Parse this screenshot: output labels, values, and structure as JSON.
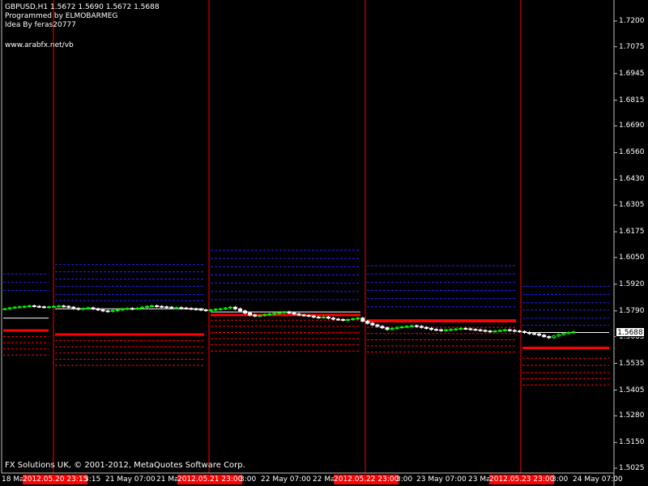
{
  "header": {
    "symbol_line": "GBPUSD,H1  1.5672 1.5690 1.5672 1.5688",
    "line2": "Programmed by ELMOBARMEG",
    "line3": "Idea By feras20777",
    "url": "www.arabfx.net/vb"
  },
  "current_price": "1.5688",
  "footer": "FX Solutions UK, © 2001-2012, MetaQuotes Software Corp.",
  "x_labels": [
    {
      "text": "18 Ma",
      "red": false
    },
    {
      "text": "2012.05.20 23:15",
      "red": true
    },
    {
      "text": "3:15",
      "red": false
    },
    {
      "text": "21 May 07:00",
      "red": false
    },
    {
      "text": "21 Ma",
      "red": false
    },
    {
      "text": "2012.05.21 23:00",
      "red": true
    },
    {
      "text": "3:00",
      "red": false
    },
    {
      "text": "22 May 07:00",
      "red": false
    },
    {
      "text": "22 Ma",
      "red": false
    },
    {
      "text": "2012.05.22 23:00",
      "red": true
    },
    {
      "text": "3:00",
      "red": false
    },
    {
      "text": "23 May 07:00",
      "red": false
    },
    {
      "text": "23 Ma",
      "red": false
    },
    {
      "text": "2012.05.23 23:00",
      "red": true
    },
    {
      "text": "3:00",
      "red": false
    },
    {
      "text": "24 May 07:00",
      "red": false
    }
  ],
  "colors": {
    "background": "#000000",
    "candle_up": "#00ff00",
    "candle_down": "#ffffff",
    "separator": "#ff0000",
    "pivot": "#ff0000",
    "resistance": "#2020ff",
    "support": "#ff0000"
  },
  "chart_data": {
    "type": "candlestick",
    "ylim": [
      1.5025,
      1.7255
    ],
    "y_ticks": [
      "1.7200",
      "1.7075",
      "1.6945",
      "1.6815",
      "1.6690",
      "1.6560",
      "1.6430",
      "1.6305",
      "1.6175",
      "1.6050",
      "1.5920",
      "1.5790",
      "1.5665",
      "1.5535",
      "1.5405",
      "1.5280",
      "1.5150",
      "1.5025"
    ],
    "sessions": [
      {
        "pivot": 1.5695,
        "prev_close": 1.5755,
        "resistance": [
          1.589,
          1.593,
          1.597
        ],
        "support": [
          1.5665,
          1.5635,
          1.5605,
          1.5575
        ]
      },
      {
        "pivot": 1.5675,
        "prev_close": 1.58,
        "resistance": [
          1.584,
          1.587,
          1.591,
          1.5945,
          1.598,
          1.6015
        ],
        "support": [
          1.5645,
          1.5615,
          1.5585,
          1.5555,
          1.5525
        ]
      },
      {
        "pivot": 1.577,
        "prev_close": 1.5785,
        "resistance": [
          1.5845,
          1.5885,
          1.5925,
          1.5965,
          1.6005,
          1.6045,
          1.6085
        ],
        "support": [
          1.5745,
          1.5715,
          1.5685,
          1.5655,
          1.5625,
          1.5595
        ]
      },
      {
        "pivot": 1.574,
        "prev_close": 1.5745,
        "resistance": [
          1.581,
          1.585,
          1.589,
          1.593,
          1.597,
          1.601
        ],
        "support": [
          1.571,
          1.568,
          1.565,
          1.562,
          1.559
        ]
      },
      {
        "pivot": 1.561,
        "prev_close": 1.5685,
        "resistance": [
          1.572,
          1.5755,
          1.5795,
          1.583,
          1.587,
          1.591
        ],
        "support": [
          1.556,
          1.5525,
          1.549,
          1.546,
          1.543
        ]
      }
    ],
    "closes": [
      1.58,
      1.5805,
      1.5808,
      1.581,
      1.5812,
      1.5815,
      1.5812,
      1.581,
      1.5808,
      1.581,
      1.5812,
      1.5814,
      1.5812,
      1.5808,
      1.5802,
      1.5798,
      1.5802,
      1.5805,
      1.58,
      1.5795,
      1.579,
      1.5788,
      1.5792,
      1.5795,
      1.58,
      1.5802,
      1.58,
      1.5803,
      1.5808,
      1.5812,
      1.5815,
      1.5812,
      1.581,
      1.5808,
      1.5805,
      1.5806,
      1.5804,
      1.5802,
      1.58,
      1.5798,
      1.5795,
      1.5792,
      1.5795,
      1.5798,
      1.58,
      1.5804,
      1.5808,
      1.58,
      1.579,
      1.578,
      1.577,
      1.5765,
      1.5768,
      1.5772,
      1.5775,
      1.5778,
      1.5782,
      1.5785,
      1.578,
      1.5775,
      1.577,
      1.5768,
      1.5765,
      1.576,
      1.5758,
      1.576,
      1.5755,
      1.575,
      1.5748,
      1.5745,
      1.5748,
      1.5752,
      1.5755,
      1.574,
      1.573,
      1.5722,
      1.5715,
      1.5708,
      1.57,
      1.5705,
      1.571,
      1.5712,
      1.5715,
      1.5718,
      1.5715,
      1.571,
      1.5705,
      1.57,
      1.5698,
      1.5695,
      1.5698,
      1.57,
      1.5702,
      1.5705,
      1.5703,
      1.57,
      1.5698,
      1.5695,
      1.5692,
      1.569,
      1.5692,
      1.5695,
      1.5698,
      1.5695,
      1.5692,
      1.569,
      1.5685,
      1.568,
      1.5678,
      1.5672,
      1.5665,
      1.566,
      1.5668,
      1.5675,
      1.568,
      1.5685,
      1.5688
    ]
  }
}
